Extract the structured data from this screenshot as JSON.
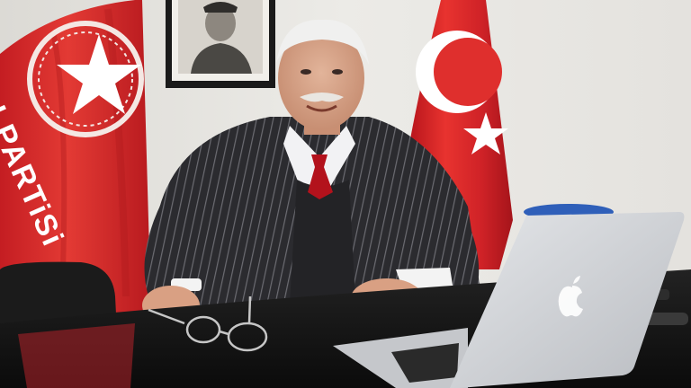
{
  "flag_left": {
    "text": "I PARTiSi"
  },
  "colors": {
    "wall": "#e9e7e3",
    "flag_red": "#d8262b",
    "suit": "#2c2c30",
    "tie": "#b3121c",
    "desk": "#141414",
    "laptop": "#cfd2d6"
  },
  "icons": {
    "apple_logo": "apple-logo-icon",
    "crescent_star": "crescent-star-icon",
    "party_emblem": "party-emblem-icon"
  }
}
